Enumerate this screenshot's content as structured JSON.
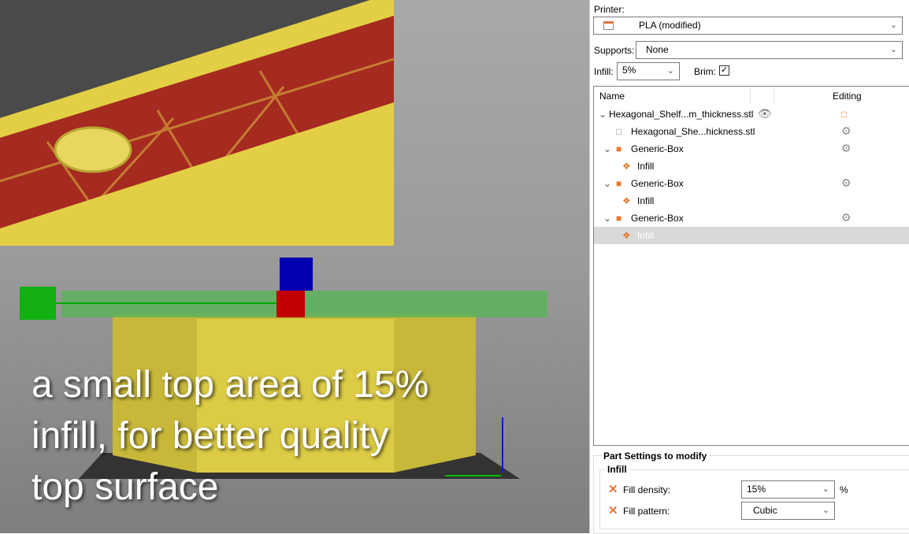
{
  "caption": [
    "a small top area of 15%",
    "infill, for better quality",
    "top surface"
  ],
  "panel": {
    "printer_label": "Printer:",
    "printer_value": "PLA (modified)",
    "supports_label": "Supports:",
    "supports_value": "None",
    "infill_label": "Infill:",
    "infill_value": "5%",
    "brim_label": "Brim:",
    "brim_checked": true
  },
  "tree": {
    "col_name": "Name",
    "col_editing": "Editing",
    "rows": [
      {
        "label": "Hexagonal_Shelf...m_thickness.stl"
      },
      {
        "label": "Hexagonal_She...hickness.stl"
      },
      {
        "label": "Generic-Box"
      },
      {
        "label": "Infill"
      },
      {
        "label": "Generic-Box"
      },
      {
        "label": "Infill"
      },
      {
        "label": "Generic-Box"
      },
      {
        "label": "Infill",
        "selected": true
      }
    ]
  },
  "part_settings": {
    "title": "Part Settings to modify",
    "group": "Infill",
    "fill_density_label": "Fill density:",
    "fill_density_value": "15%",
    "fill_density_unit": "%",
    "fill_pattern_label": "Fill pattern:",
    "fill_pattern_value": "Cubic"
  }
}
